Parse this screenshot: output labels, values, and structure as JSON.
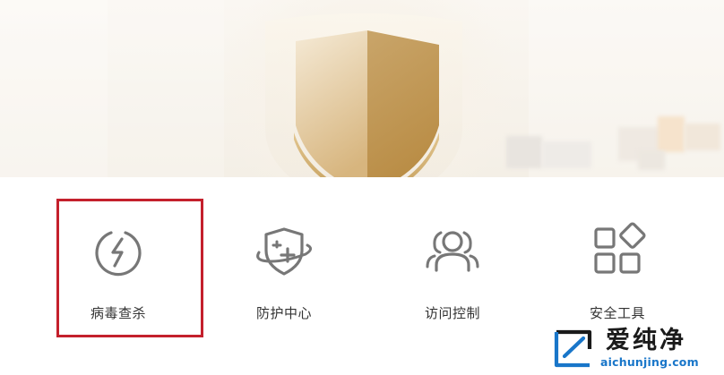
{
  "features": [
    {
      "label": "病毒查杀",
      "icon": "lightning-bolt-icon",
      "highlighted": true
    },
    {
      "label": "防护中心",
      "icon": "shield-plus-icon",
      "highlighted": false
    },
    {
      "label": "访问控制",
      "icon": "users-icon",
      "highlighted": false
    },
    {
      "label": "安全工具",
      "icon": "grid-apps-icon",
      "highlighted": false
    }
  ],
  "highlight_color": "#c4202c",
  "icon_color": "#777777",
  "shield_colors": {
    "light": "#f1e2c2",
    "dark": "#c89b55"
  },
  "watermark": {
    "cn": "爱纯净",
    "en": "aichunjing.com"
  }
}
